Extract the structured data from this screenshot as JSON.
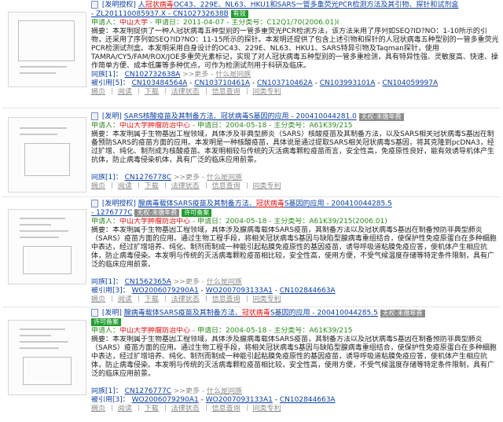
{
  "records": [
    {
      "title_kind": "[发明授权]",
      "title_pre": "人",
      "title_hl": "冠状病毒",
      "title_post": "OC43、229E、NL63、HKU1和SARS一管多重荧光PCR检测方法及其引物、探针和试剂盒",
      "pub_no": "201110085937.X",
      "pub_no2": "102732638B",
      "tag": "有效",
      "applicant_label": "申请人：",
      "applicant": "中山大学",
      "date_label": "申请日：",
      "date": "2011-04-07",
      "ipc_label": "主分类号：",
      "ipc": "C12Q1/70(2006.01)I",
      "abstract": "摘要：本发明提供了一种人冠状病毒五种型别的一管多重荧光PCR检测方法，该方法采用了序列如SEQ?ID?NO：1-10所示的引物，还采用了序列如SEQ?ID?NO：11-15所示的探针。本发明还提供了包含上述引物和探针的人冠状病毒五种型别的一管多重荧光PCR检测试剂盒。本发明采用自身设计的OC43、229E、NL63、HKU1、SARS特异引物及Taqman探针，使用TAMRA/CY5/FAM/ROX/JOE多重荧光素标记，实现了对人冠状病毒五种型别的一管多重检测，具有特异性强、灵敏度高、快速、操作简单方便、成本低廉等多种优点，可作为检测试剂用于科研及临床。",
      "tongzu": "同族[1]：",
      "tongzu_link": "CN102732638A",
      "more": ">>更多",
      "what_same": "什么是同族",
      "cited": "被引用[5]：",
      "cited_links": [
        "CN103484564A",
        "CN103710461A",
        "CN103710462A",
        "CN103993101A",
        "CN104059997A"
      ],
      "actions": [
        "摘页",
        "阅读",
        "下载",
        "法律状态",
        "信息查询",
        "同类专利"
      ]
    },
    {
      "title_kind": "[发明]",
      "title_pre": "",
      "title_hl": "",
      "title_post": "SARS核酸疫苗及其制备方法、冠状病毒S基因的应用 - 200410044281.0",
      "pub_no": "",
      "pub_no2": "",
      "tag": "无权-未缴年费",
      "applicant_label": "申请人：",
      "applicant": "中山大学肿瘤防治中心",
      "date_label": "申请日：",
      "date": "2004-05-18",
      "ipc_label": "主分类号：",
      "ipc": "A61K39/215",
      "abstract": "摘要：本发明属于生物基因工程领域，具体涉及非典型肺炎（SARS）核酸疫苗及其制备方法，以及SARS相关冠状病毒S基因在制备预防SARS的疫苗方面的应用。本发明是一种核酸疫苗，具体说是通过提取SARS相关冠状病毒S基因，将其克隆到pcDNA3，经过扩增、纯化、制剂成为核酸疫苗。本发明相较与传统的灭活病毒颗粒疫苗而言，安全性高，免疫原性良好，能有效诱导机体产生抗体，防止病毒侵染机体，具有广泛的临床应用前景。",
      "tongzu": "同族[1]：",
      "tongzu_link": "CN1276778C",
      "more": ">>更多",
      "what_same": "什么是同族",
      "cited": "",
      "cited_links": [],
      "actions": [
        "摘页",
        "阅读",
        "下载",
        "法律状态",
        "信息查询",
        "同类专利"
      ]
    },
    {
      "title_kind": "[发明授权]",
      "title_pre": "腺病毒载体SARS疫苗及其制备方法、",
      "title_hl": "冠状病毒",
      "title_post": "S基因的应用 - 200410044285.5",
      "pub_no": "1276777C",
      "pub_no2": "",
      "tag": "无权-未缴年费",
      "tag2": "许可备案",
      "applicant_label": "申请人：",
      "applicant": "中山大学肿瘤防治中心",
      "date_label": "申请日：",
      "date": "2004-05-18",
      "ipc_label": "主分类号：",
      "ipc": "A61K39/215(2006.01)",
      "abstract": "摘要：本发明属于生物基因工程领域，具体涉及腺病毒载体SARS疫苗，其制备方法以及冠状病毒S基因在制备预防非典型肺炎（SARS）疫苗方面的应用。通过生物工程手段，将相关冠状病毒S基因与缺陷型腺病毒重组结合，使保护性免疫原蛋白在多种细胞中表达，经过扩增培养、纯化、制剂而制成一种能引起粘膜免疫原性的基因疫苗，诱导呼吸道粘膜免疫应答，使机体产生相应抗体，防止病毒侵染。本发明与传统的灭活病毒颗粒疫苗相比较，安全性高，使用方便，不受气候温度存储等特定条件限制，具有广泛的临床应用前景。",
      "tongzu": "同族[1]：",
      "tongzu_link": "CN1562365A",
      "more": ">>更多",
      "what_same": "什么是同族",
      "cited": "被引用[3]：",
      "cited_links": [
        "WO2006079290A1",
        "WO2007093133A1",
        "CN102844663A"
      ],
      "actions": [
        "摘页",
        "阅读",
        "下载",
        "法律状态",
        "信息查询",
        "同类专利"
      ]
    },
    {
      "title_kind": "[发明]",
      "title_pre": "腺病毒载体SARS疫苗及其制备方法、",
      "title_hl": "冠状病毒",
      "title_post": "S基因的应用 - 200410044285.5",
      "pub_no": "",
      "pub_no2": "",
      "tag": "无权-未缴年费",
      "tag2": "许可备案",
      "applicant_label": "申请人：",
      "applicant": "中山大学肿瘤防治中心",
      "date_label": "申请日：",
      "date": "2004-05-18",
      "ipc_label": "主分类号：",
      "ipc": "A61K39/215",
      "abstract": "摘要：本发明属于生物基因工程领域，具体涉及腺病毒载体SARS疫苗，其制备方法以及冠状病毒S基因在制备预防非典型肺炎（SARS）疫苗方面的应用。通过生物工程手段，将相关冠状病毒S基因与缺陷型腺病毒重组结合，使保护性免疫原蛋白在多种细胞中表达，经过扩增培养、纯化、制剂而制成一种能引起粘膜免疫原性的基因疫苗，诱导呼吸道粘膜免疫应答，使机体产生相应抗体，防止病毒侵染。本发明与传统的灭活病毒颗粒疫苗相比较，安全性高，使用方便，不受气候温度存储等特定条件限制，具有广泛的临床应用前景。",
      "tongzu": "同族[1]：",
      "tongzu_link": "CN1276777C",
      "more": ">>更多",
      "what_same": "什么是同族",
      "cited": "被引用[3]：",
      "cited_links": [
        "WO2006079290A1",
        "WO2007093133A1",
        "CN102844663A"
      ],
      "actions": [
        "摘页",
        "阅读",
        "下载",
        "法律状态",
        "信息查询",
        "同类专利"
      ]
    }
  ]
}
